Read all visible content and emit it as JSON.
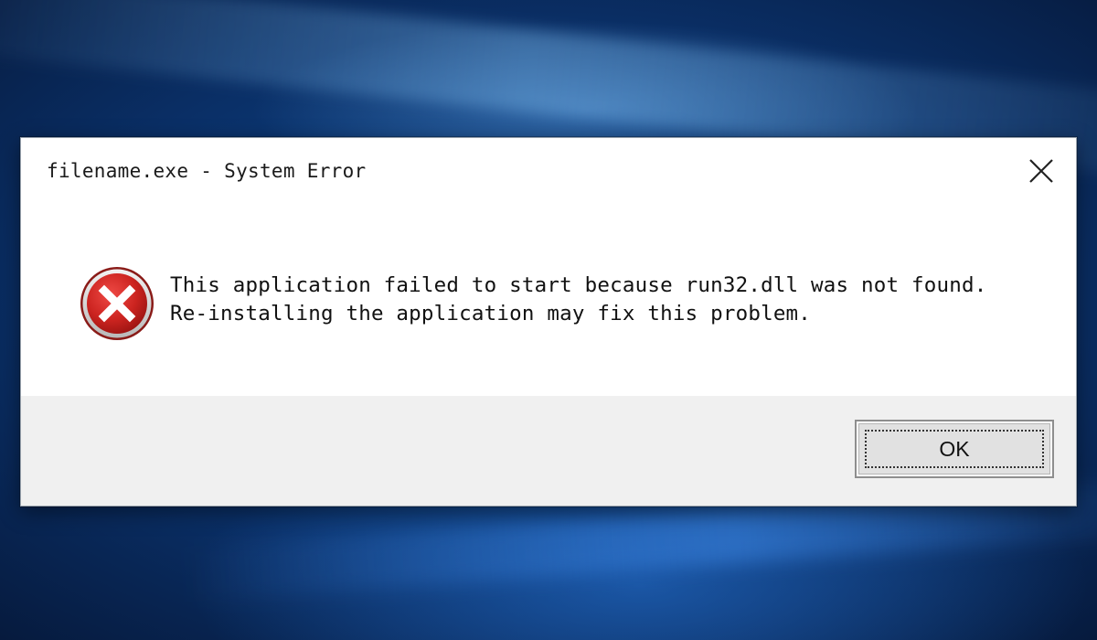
{
  "dialog": {
    "title": "filename.exe - System Error",
    "message": "This application failed to start because run32.dll was not found. Re-installing the application may fix this problem.",
    "icon": "error-icon",
    "close_icon": "close-icon",
    "ok_label": "OK"
  },
  "colors": {
    "desktop_blue": "#0f4d98",
    "error_red": "#c8201f",
    "footer_gray": "#f0f0f0"
  }
}
